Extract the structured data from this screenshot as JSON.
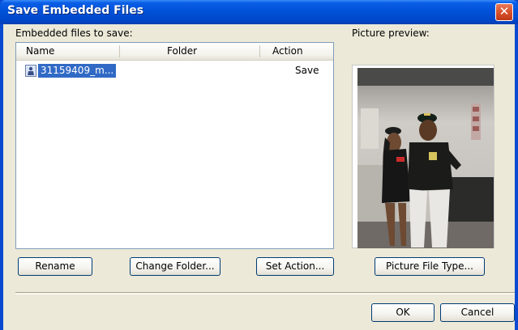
{
  "window": {
    "title": "Save Embedded Files",
    "close_symbol": "✕"
  },
  "labels": {
    "embedded_files": "Embedded files to save:",
    "picture_preview": "Picture preview:"
  },
  "list": {
    "columns": [
      "Name",
      "Folder",
      "Action"
    ],
    "rows": [
      {
        "icon": "image-file-icon",
        "name": "31159409_m...",
        "folder": "",
        "action": "Save",
        "selected": true
      }
    ]
  },
  "buttons": {
    "rename": "Rename",
    "change_folder": "Change Folder...",
    "set_action": "Set Action...",
    "picture_file_type": "Picture File Type...",
    "ok": "OK",
    "cancel": "Cancel"
  },
  "colors": {
    "titlebar": "#0052d8",
    "dialog_bg": "#ece9d8",
    "selection": "#316ac5",
    "close_button": "#d9512a"
  }
}
